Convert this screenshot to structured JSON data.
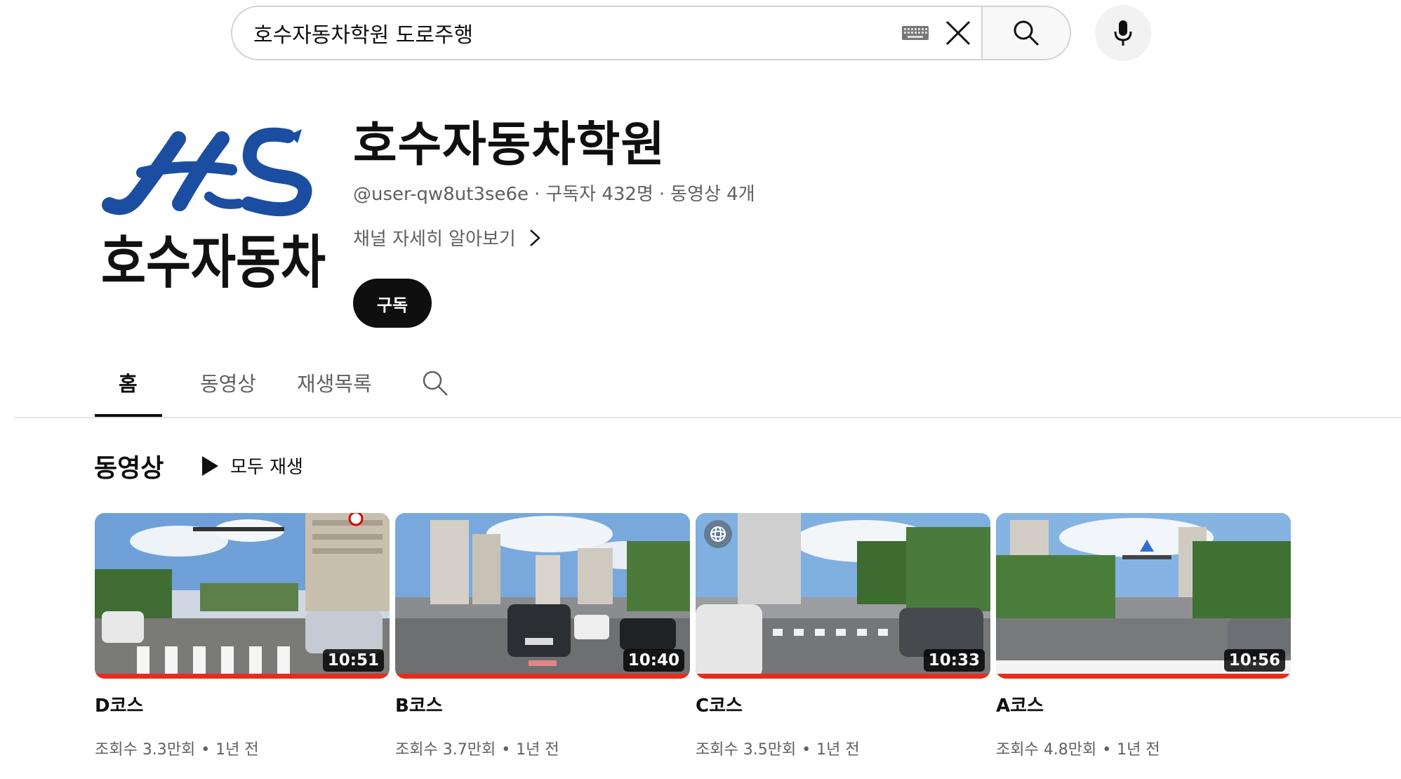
{
  "search": {
    "query": "호수자동차학원 도로주행"
  },
  "channel": {
    "logo_text": "HS 호수자동차",
    "name": "호수자동차학원",
    "handle": "@user-qw8ut3se6e",
    "subscribers": "구독자 432명",
    "video_count": "동영상 4개",
    "about_link": "채널 자세히 알아보기",
    "subscribe_label": "구독"
  },
  "tabs": [
    {
      "label": "홈",
      "active": true
    },
    {
      "label": "동영상",
      "active": false
    },
    {
      "label": "재생목록",
      "active": false
    }
  ],
  "section": {
    "title": "동영상",
    "play_all_label": "모두 재생"
  },
  "videos": [
    {
      "title": "D코스",
      "duration": "10:51",
      "views": "조회수 3.3만회",
      "age": "1년 전"
    },
    {
      "title": "B코스",
      "duration": "10:40",
      "views": "조회수 3.7만회",
      "age": "1년 전"
    },
    {
      "title": "C코스",
      "duration": "10:33",
      "views": "조회수 3.5만회",
      "age": "1년 전"
    },
    {
      "title": "A코스",
      "duration": "10:56",
      "views": "조회수 4.8만회",
      "age": "1년 전"
    }
  ],
  "colors": {
    "progress": "#e92b1a",
    "logo_blue": "#1b4ea1",
    "text_secondary": "#606060"
  },
  "icons": [
    "keyboard-icon",
    "close-icon",
    "search-icon",
    "mic-icon",
    "chevron-right-icon",
    "play-icon",
    "openai-watermark-icon"
  ]
}
